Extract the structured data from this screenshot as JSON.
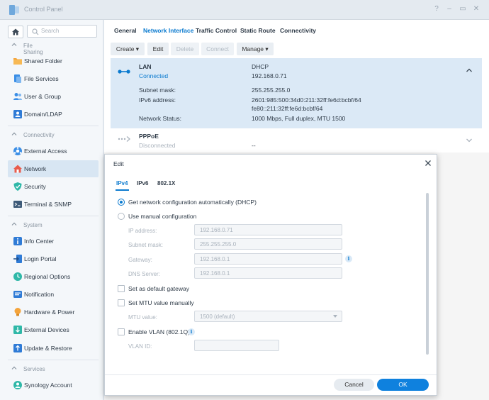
{
  "window": {
    "title": "Control Panel",
    "controls": [
      "?",
      "–",
      "▭",
      "✕"
    ]
  },
  "sidebar": {
    "search_placeholder": "Search",
    "sections": [
      {
        "label": "File Sharing"
      },
      {
        "label": "Connectivity"
      },
      {
        "label": "System"
      },
      {
        "label": "Services"
      }
    ],
    "items": [
      {
        "label": "Shared Folder",
        "icon": "shared-folder-icon"
      },
      {
        "label": "File Services",
        "icon": "file-services-icon"
      },
      {
        "label": "User & Group",
        "icon": "user-group-icon"
      },
      {
        "label": "Domain/LDAP",
        "icon": "domain-ldap-icon"
      },
      {
        "label": "External Access",
        "icon": "external-access-icon"
      },
      {
        "label": "Network",
        "icon": "network-house-icon"
      },
      {
        "label": "Security",
        "icon": "shield-icon"
      },
      {
        "label": "Terminal & SNMP",
        "icon": "terminal-icon"
      },
      {
        "label": "Info Center",
        "icon": "info-center-icon"
      },
      {
        "label": "Login Portal",
        "icon": "login-portal-icon"
      },
      {
        "label": "Regional Options",
        "icon": "globe-clock-icon"
      },
      {
        "label": "Notification",
        "icon": "notification-icon"
      },
      {
        "label": "Hardware & Power",
        "icon": "bulb-icon"
      },
      {
        "label": "External Devices",
        "icon": "external-devices-icon"
      },
      {
        "label": "Update & Restore",
        "icon": "update-restore-icon"
      },
      {
        "label": "Synology Account",
        "icon": "account-icon"
      }
    ]
  },
  "tabs": [
    "General",
    "Network Interface",
    "Traffic Control",
    "Static Route",
    "Connectivity"
  ],
  "toolbar": {
    "create": "Create ▾",
    "edit": "Edit",
    "delete": "Delete",
    "connect": "Connect",
    "manage": "Manage ▾"
  },
  "lan": {
    "name": "LAN",
    "status": "Connected",
    "mode": "DHCP",
    "ip": "192.168.0.71",
    "subnet_label": "Subnet mask:",
    "subnet": "255.255.255.0",
    "ipv6_label": "IPv6 address:",
    "ipv6_1": "2601:985:500:34d0:211:32ff:fe6d:bcbf/64",
    "ipv6_2": "fe80::211:32ff:fe6d:bcbf/64",
    "netstat_label": "Network Status:",
    "netstat": "1000 Mbps, Full duplex, MTU 1500"
  },
  "pppoe": {
    "name": "PPPoE",
    "status": "Disconnected",
    "value": "--"
  },
  "dialog": {
    "title": "Edit",
    "tabs": [
      "IPv4",
      "IPv6",
      "802.1X"
    ],
    "opt_dhcp": "Get network configuration automatically (DHCP)",
    "opt_manual": "Use manual configuration",
    "ip_label": "IP address:",
    "ip_value": "192.168.0.71",
    "subnet_label": "Subnet mask:",
    "subnet_value": "255.255.255.0",
    "gateway_label": "Gateway:",
    "gateway_value": "192.168.0.1",
    "dns_label": "DNS Server:",
    "dns_value": "192.168.0.1",
    "default_gateway": "Set as default gateway",
    "mtu_manual": "Set MTU value manually",
    "mtu_label": "MTU value:",
    "mtu_value": "1500 (default)",
    "vlan": "Enable VLAN (802.1Q)",
    "vlan_id_label": "VLAN ID:",
    "vlan_id_value": "",
    "cancel": "Cancel",
    "ok": "OK"
  },
  "colors": {
    "accent": "#0a7acf",
    "ok_button": "#0f81de",
    "selected_row": "#dbe9f6",
    "connected": "#0a7acf",
    "disconnected": "#aab3bd"
  }
}
